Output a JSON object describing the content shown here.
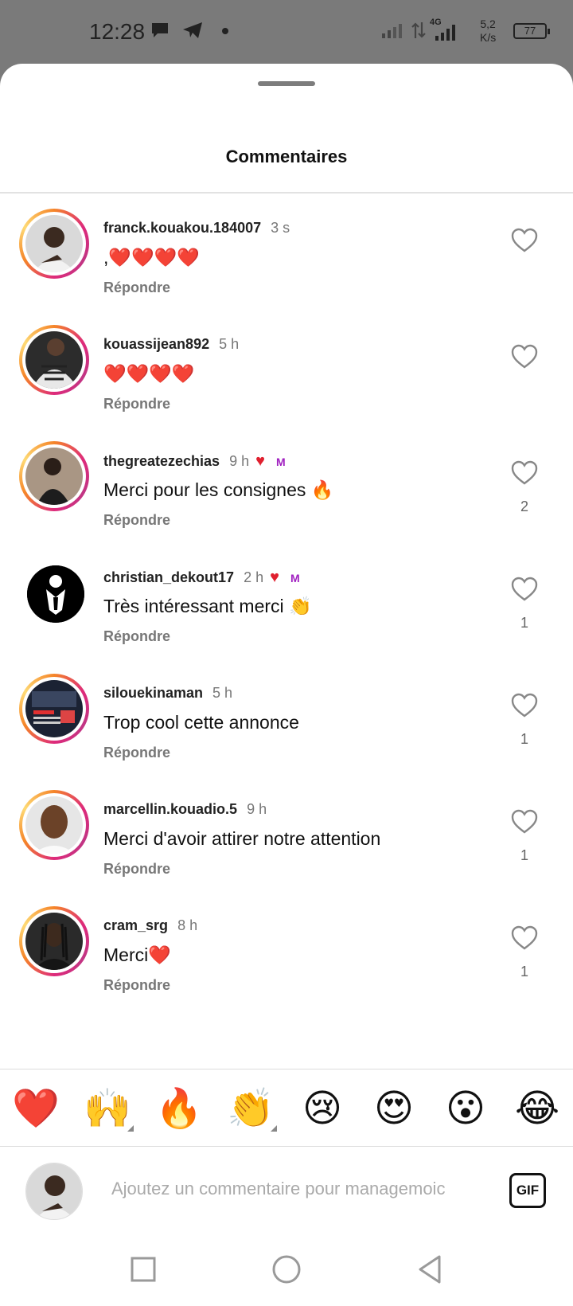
{
  "status_bar": {
    "time": "12:28",
    "network": "4G",
    "speed_value": "5,2",
    "speed_unit": "K/s",
    "battery": "77"
  },
  "sheet": {
    "title": "Commentaires"
  },
  "comments": [
    {
      "user": "franck.kouakou.184007",
      "time": "3 s",
      "text": ",❤️❤️❤️❤️",
      "reply": "Répondre",
      "likes": "",
      "author_liked": false,
      "avatar_style": "light"
    },
    {
      "user": "kouassijean892",
      "time": "5 h",
      "text": "❤️❤️❤️❤️",
      "reply": "Répondre",
      "likes": "",
      "author_liked": false,
      "avatar_style": "dark"
    },
    {
      "user": "thegreatezechias",
      "time": "9 h",
      "text": "Merci pour les consignes 🔥",
      "reply": "Répondre",
      "likes": "2",
      "author_liked": true,
      "avatar_style": "photo"
    },
    {
      "user": "christian_dekout17",
      "time": "2 h",
      "text": "Très intéressant merci 👏",
      "reply": "Répondre",
      "likes": "1",
      "author_liked": true,
      "avatar_style": "black"
    },
    {
      "user": "silouekinaman",
      "time": "5 h",
      "text": "Trop cool cette annonce",
      "reply": "Répondre",
      "likes": "1",
      "author_liked": false,
      "avatar_style": "flyer"
    },
    {
      "user": "marcellin.kouadio.5",
      "time": "9 h",
      "text": "Merci d'avoir attirer notre attention",
      "reply": "Répondre",
      "likes": "1",
      "author_liked": false,
      "avatar_style": "portrait"
    },
    {
      "user": "cram_srg",
      "time": "8 h",
      "text": "Merci❤️",
      "reply": "Répondre",
      "likes": "1",
      "author_liked": false,
      "avatar_style": "dark2"
    }
  ],
  "emoji_bar": [
    "❤️",
    "🙌",
    "🔥",
    "👏",
    "😢",
    "😍",
    "😮",
    "😂"
  ],
  "composer": {
    "placeholder": "Ajoutez un commentaire pour managemoic",
    "gif_label": "GIF"
  },
  "colors": {
    "like_red": "#e0202f",
    "muted": "#777777",
    "story_ring": "#dd2a7b"
  },
  "icons": {
    "like": "heart-outline-icon",
    "author_like": "heart-filled-icon",
    "gif": "gif-icon"
  }
}
